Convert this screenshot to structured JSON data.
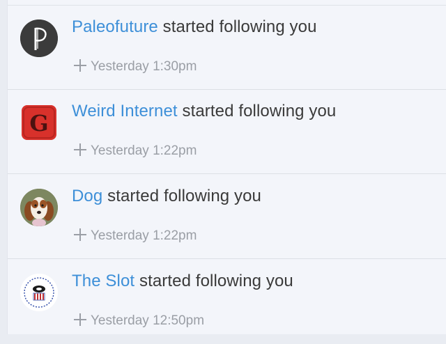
{
  "notifications": [
    {
      "actor": "Paleofuture",
      "action": "started following you",
      "time": "Yesterday 1:30pm",
      "avatar_icon": "paleofuture-logo",
      "avatar_color": "#3b3b3b"
    },
    {
      "actor": "Weird Internet",
      "action": "started following you",
      "time": "Yesterday 1:22pm",
      "avatar_icon": "weird-internet-logo",
      "avatar_color": "#d8312b"
    },
    {
      "actor": "Dog",
      "action": "started following you",
      "time": "Yesterday 1:22pm",
      "avatar_icon": "dog-photo",
      "avatar_color": "#8a6a3e"
    },
    {
      "actor": "The Slot",
      "action": "started following you",
      "time": "Yesterday 12:50pm",
      "avatar_icon": "the-slot-logo",
      "avatar_color": "#c23030"
    }
  ],
  "colors": {
    "link": "#3d8fd8",
    "text": "#3a3a3a",
    "meta": "#9a9ea5",
    "background": "#f3f5fa"
  }
}
